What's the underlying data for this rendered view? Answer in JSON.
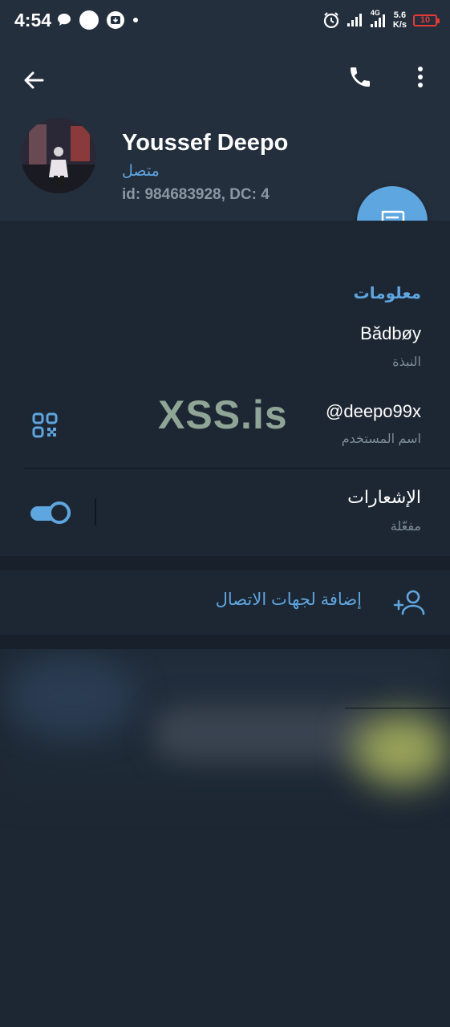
{
  "status_bar": {
    "time": "4:54",
    "net_speed_value": "5.6",
    "net_speed_unit": "K/s",
    "network_type": "4G",
    "battery": "10"
  },
  "header": {
    "name": "Youssef Deepo",
    "status": "متصل",
    "id_line": "id: 984683928, DC: 4"
  },
  "info": {
    "section_title": "معلومات",
    "bio_value": "Bădbøy",
    "bio_caption": "النبذة",
    "username_value": "@deepo99x",
    "username_caption": "اسم المستخدم",
    "notifications_label": "الإشعارات",
    "notifications_state": "مفعّلة",
    "notifications_enabled": true
  },
  "watermark": "XSS.is",
  "actions": {
    "add_contact_label": "إضافة لجهات الاتصال"
  },
  "colors": {
    "accent": "#5ea6e0",
    "background": "#1d2733",
    "header_bg": "#242f3d",
    "battery_low": "#e53935"
  }
}
